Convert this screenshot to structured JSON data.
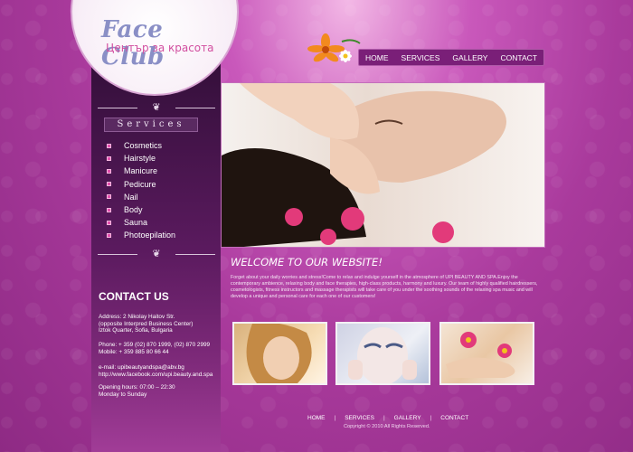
{
  "logo": {
    "title": "Face Club",
    "subtitle": "Център за красота"
  },
  "nav": {
    "items": [
      "HOME",
      "SERVICES",
      "GALLERY",
      "CONTACT"
    ]
  },
  "sidebar": {
    "services_title": "Services",
    "services": [
      "Cosmetics",
      "Hairstyle",
      "Manicure",
      "Pedicure",
      "Nail",
      "Body",
      "Sauna",
      "Photoepilation"
    ]
  },
  "contact": {
    "title": "CONTACT US",
    "address_lines": [
      "Address: 2 Nikolay Haitov Str.",
      "(opposite Interpred Business Center)",
      "Iztok Quarter, Sofia, Bulgaria"
    ],
    "phone_lines": [
      "Phone: + 359 (02) 870 1999, (02) 870 2999",
      "Mobile: + 359 885 80 66 44"
    ],
    "email_lines": [
      "e-mail: upibeautyandspa@abv.bg",
      "http://www.facebook.com/upi.beauty.and.spa"
    ],
    "hours_lines": [
      "Opening hours: 07:00 – 22:30",
      "Monday to Sunday"
    ]
  },
  "main": {
    "welcome": "WELCOME TO OUR WEBSITE!",
    "intro": "Forget about your daily worries and stress!Come to relax and indulge yourself in the atmosphere of UPI BEAUTY AND SPA.Enjoy the contemporary ambience, relaxing body and face therapies, high-class products, harmony and luxury. Our team of highly qualified hairdressers, cosmetologists, fitness instructors and massage therapists will take care of you under the soothing sounds of the relaxing spa music and will develop a unique and personal care for each one of our customers!"
  },
  "footer": {
    "nav": [
      "HOME",
      "SERVICES",
      "GALLERY",
      "CONTACT"
    ],
    "copyright": "Copyright © 2010 All Rights Reserved."
  },
  "colors": {
    "accent": "#e44fae",
    "nav_bg": "#7a1f78",
    "sidebar_dark": "#2a0a2c"
  }
}
